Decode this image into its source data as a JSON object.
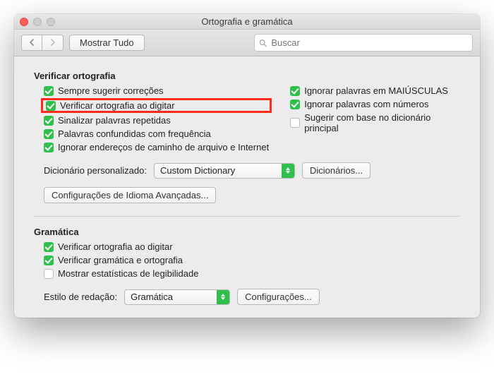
{
  "window": {
    "title": "Ortografia e gramática"
  },
  "toolbar": {
    "show_all": "Mostrar Tudo",
    "search_placeholder": "Buscar"
  },
  "spelling": {
    "heading": "Verificar ortografia",
    "left": [
      {
        "label": "Sempre sugerir correções",
        "checked": true
      },
      {
        "label": "Verificar ortografia ao digitar",
        "checked": true,
        "highlighted": true
      },
      {
        "label": "Sinalizar palavras repetidas",
        "checked": true
      },
      {
        "label": "Palavras confundidas com frequência",
        "checked": true
      },
      {
        "label": "Ignorar endereços de caminho de arquivo e Internet",
        "checked": true
      }
    ],
    "right": [
      {
        "label": "Ignorar palavras em MAIÚSCULAS",
        "checked": true
      },
      {
        "label": "Ignorar palavras com números",
        "checked": true
      },
      {
        "label": "Sugerir com base no dicionário principal",
        "checked": false
      }
    ],
    "custom_dict_label": "Dicionário personalizado:",
    "custom_dict_value": "Custom Dictionary",
    "dictionaries_btn": "Dicionários...",
    "advanced_btn": "Configurações de Idioma Avançadas..."
  },
  "grammar": {
    "heading": "Gramática",
    "items": [
      {
        "label": "Verificar ortografia ao digitar",
        "checked": true
      },
      {
        "label": "Verificar gramática e ortografia",
        "checked": true
      },
      {
        "label": "Mostrar estatísticas de legibilidade",
        "checked": false
      }
    ],
    "style_label": "Estilo de redação:",
    "style_value": "Gramática",
    "settings_btn": "Configurações..."
  }
}
